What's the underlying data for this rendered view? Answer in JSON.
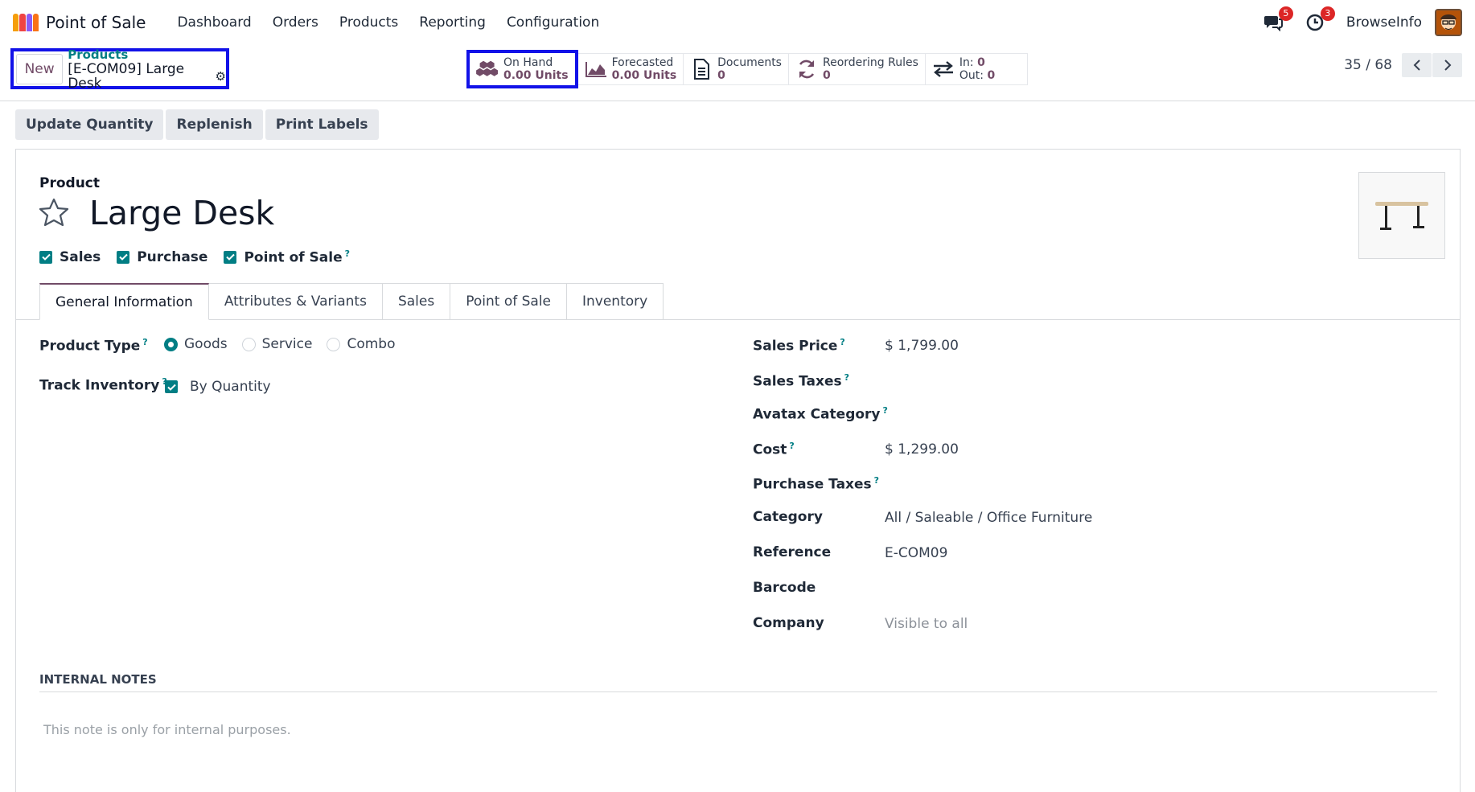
{
  "app": {
    "title": "Point of Sale",
    "logo_colors": [
      "#f59e0b",
      "#ef4444",
      "#8b5cf6",
      "#f97316"
    ]
  },
  "menu": [
    "Dashboard",
    "Orders",
    "Products",
    "Reporting",
    "Configuration"
  ],
  "systray": {
    "messages_count": "5",
    "activities_count": "3",
    "company": "BrowseInfo"
  },
  "breadcrumb": {
    "new_label": "New",
    "parent": "Products",
    "current": "[E-COM09] Large Desk"
  },
  "smart_buttons": {
    "on_hand": {
      "label": "On Hand",
      "value": "0.00 Units"
    },
    "forecasted": {
      "label": "Forecasted",
      "value": "0.00 Units"
    },
    "documents": {
      "label": "Documents",
      "value": "0"
    },
    "reordering": {
      "label": "Reordering Rules",
      "value": "0"
    },
    "in_out": {
      "in_label": "In:",
      "in_value": "0",
      "out_label": "Out:",
      "out_value": "0"
    }
  },
  "pager": {
    "value": "35 / 68"
  },
  "actions": [
    "Update Quantity",
    "Replenish",
    "Print Labels"
  ],
  "product": {
    "label": "Product",
    "name": "Large Desk",
    "flags": [
      {
        "label": "Sales",
        "checked": true
      },
      {
        "label": "Purchase",
        "checked": true
      },
      {
        "label": "Point of Sale",
        "checked": true,
        "help": "?"
      }
    ]
  },
  "tabs": [
    "General Information",
    "Attributes & Variants",
    "Sales",
    "Point of Sale",
    "Inventory"
  ],
  "general": {
    "product_type": {
      "label": "Product Type",
      "help": "?",
      "options": [
        "Goods",
        "Service",
        "Combo"
      ],
      "selected": "Goods"
    },
    "track_inventory": {
      "label": "Track Inventory",
      "help": "?",
      "option": "By Quantity",
      "checked": true
    },
    "sales_price": {
      "label": "Sales Price",
      "help": "?",
      "value": "$ 1,799.00"
    },
    "sales_taxes": {
      "label": "Sales Taxes",
      "help": "?",
      "value": ""
    },
    "avatax_category": {
      "label": "Avatax Category",
      "help": "?",
      "value": ""
    },
    "cost": {
      "label": "Cost",
      "help": "?",
      "value": "$ 1,299.00"
    },
    "purchase_taxes": {
      "label": "Purchase Taxes",
      "help": "?",
      "value": ""
    },
    "category": {
      "label": "Category",
      "value": "All / Saleable / Office Furniture"
    },
    "reference": {
      "label": "Reference",
      "value": "E-COM09"
    },
    "barcode": {
      "label": "Barcode",
      "value": ""
    },
    "company": {
      "label": "Company",
      "value": "Visible to all"
    }
  },
  "notes": {
    "title": "INTERNAL NOTES",
    "placeholder": "This note is only for internal purposes."
  },
  "colors": {
    "primary": "#714b67",
    "teal": "#017e84",
    "highlight": "#1212e8"
  }
}
